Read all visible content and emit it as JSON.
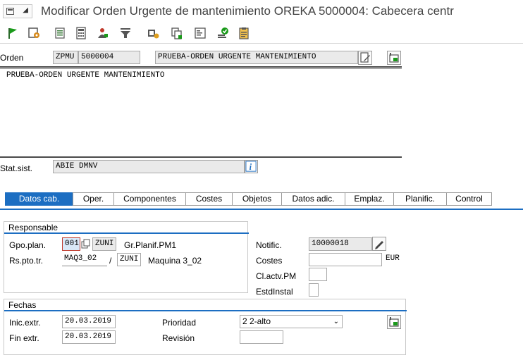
{
  "window": {
    "title": "Modificar Orden Urgente de mantenimiento OREKA 5000004: Cabecera centr"
  },
  "toolbar": {
    "icons": [
      "flag-icon",
      "settings-icon",
      "document-icon",
      "calculator-icon",
      "person-icon",
      "funnel-icon",
      "cost-icon",
      "copy-icon",
      "list-icon",
      "checkmark-icon",
      "clipboard-icon"
    ]
  },
  "header": {
    "order_label": "Orden",
    "order_type": "ZPMU",
    "order_number": "5000004",
    "order_desc": "PRUEBA-ORDEN URGENTE MANTENIMIENTO",
    "long_text": "PRUEBA-ORDEN URGENTE MANTENIMIENTO",
    "status_label": "Stat.sist.",
    "status_value": "ABIE DMNV"
  },
  "tabs": [
    {
      "label": "Datos cab.",
      "active": true
    },
    {
      "label": "Oper."
    },
    {
      "label": "Componentes"
    },
    {
      "label": "Costes"
    },
    {
      "label": "Objetos"
    },
    {
      "label": "Datos adic."
    },
    {
      "label": "Emplaz."
    },
    {
      "label": "Planific."
    },
    {
      "label": "Control"
    }
  ],
  "responsable": {
    "title": "Responsable",
    "gpo_label": "Gpo.plan.",
    "gpo_value": "001",
    "gpo_center": "ZUNI",
    "gpo_desc": "Gr.Planif.PM1",
    "rs_label": "Rs.pto.tr.",
    "rs_value": "MAQ3_02",
    "rs_sep": "/",
    "rs_center": "ZUNI",
    "rs_desc": "Maquina 3_02"
  },
  "right_fields": {
    "notif_label": "Notific.",
    "notif_value": "10000018",
    "costes_label": "Costes",
    "costes_value": "",
    "currency": "EUR",
    "clactv_label": "Cl.actv.PM",
    "clactv_value": "",
    "estd_label": "EstdInstal",
    "estd_value": ""
  },
  "fechas": {
    "title": "Fechas",
    "inic_label": "Inic.extr.",
    "inic_value": "20.03.2019",
    "fin_label": "Fin extr.",
    "fin_value": "20.03.2019",
    "prioridad_label": "Prioridad",
    "prioridad_value": "2 2-alto",
    "revision_label": "Revisión",
    "revision_value": ""
  },
  "colors": {
    "accent": "#1c6ec2",
    "field_bg": "#eaeaea",
    "title_text": "#444444"
  }
}
